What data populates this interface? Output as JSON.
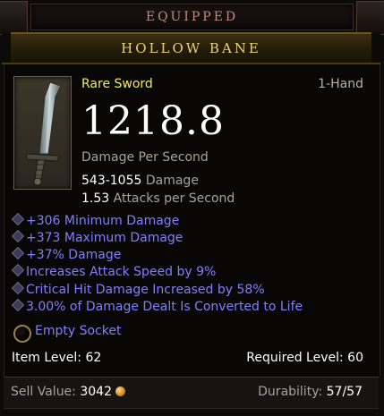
{
  "header": {
    "equipped_label": "EQUIPPED"
  },
  "item": {
    "name": "HOLLOW BANE",
    "type": "Rare Sword",
    "slot": "1-Hand",
    "dps": "1218.8",
    "dps_label": "Damage Per Second",
    "damage_range": "543-1055",
    "damage_label": "Damage",
    "attack_speed": "1.53",
    "attack_speed_label": "Attacks per Second",
    "icon": "sword-icon"
  },
  "affixes": [
    "+306 Minimum Damage",
    "+373 Maximum Damage",
    "+37% Damage",
    "Increases Attack Speed by 9%",
    "Critical Hit Damage Increased by 58%",
    "3.00% of Damage Dealt Is Converted to Life"
  ],
  "socket": {
    "label": "Empty Socket",
    "icon": "socket-icon"
  },
  "levels": {
    "item_level_label": "Item Level:",
    "item_level": "62",
    "required_level_label": "Required Level:",
    "required_level": "60"
  },
  "footer": {
    "sell_label": "Sell Value:",
    "sell_value": "3042",
    "gold_icon": "gold-coin-icon",
    "durability_label": "Durability:",
    "durability_value": "57/57"
  },
  "colors": {
    "title": "#e8d47a",
    "rare": "#f4ec5a",
    "magic_affix": "#8080ff",
    "label_grey": "#a7a39b",
    "equipped": "#c58c78"
  }
}
